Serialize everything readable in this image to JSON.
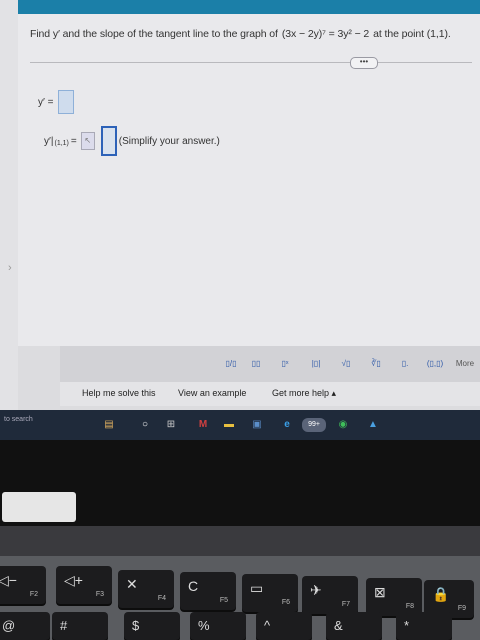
{
  "problem": {
    "text_pre": "Find y′ and the slope of the tangent line to the graph of",
    "equation": "(3x − 2y)⁷ = 3y² − 2",
    "text_post": "at the point (1,1)."
  },
  "more_pill": "•••",
  "answers": {
    "yprime_label": "y′ =",
    "slope_label": "y′|",
    "slope_point": "(1,1)",
    "slope_eq": "=",
    "hint": "(Simplify your answer.)"
  },
  "toolbar": {
    "tools": [
      "▯/▯",
      "▯▯",
      "▯ˣ",
      "|▯|",
      "√▯",
      "∛▯",
      "▯.",
      "(▯,▯)"
    ],
    "more_label": "More"
  },
  "help": {
    "solve": "Help me solve this",
    "example": "View an example",
    "more_help": "Get more help ▴"
  },
  "taskbar": {
    "search_placeholder": "to search",
    "icons": [
      "▤",
      "○",
      "⊞",
      "M",
      "▬",
      "▣",
      "e",
      "99+",
      "◉",
      "▲"
    ]
  },
  "keyboard": {
    "top_row": [
      {
        "glyph": "◁−",
        "fn": "F2"
      },
      {
        "glyph": "◁+",
        "fn": "F3"
      },
      {
        "glyph": "✕",
        "fn": "F4"
      },
      {
        "glyph": "C",
        "fn": "F5"
      },
      {
        "glyph": "▭",
        "fn": "F6"
      },
      {
        "glyph": "✈",
        "fn": "F7"
      },
      {
        "glyph": "⊠",
        "fn": "F8"
      },
      {
        "glyph": "🔒",
        "fn": "F9"
      }
    ],
    "bottom_row": [
      "@",
      "#",
      "$",
      "%",
      "^",
      "&",
      "*"
    ]
  }
}
